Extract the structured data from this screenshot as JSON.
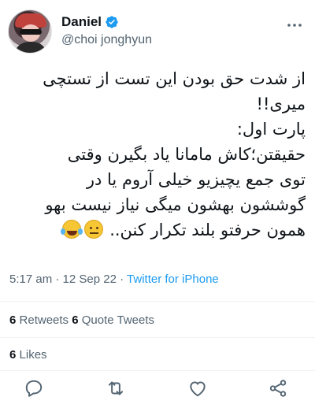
{
  "user": {
    "display_name": "Daniel",
    "handle": "@choi jonghyun",
    "verified": true
  },
  "tweet": {
    "lines": [
      "از شدت حق بودن این تست از تستچی",
      "میری!!",
      "پارت اول:",
      "حقیقتن؛کاش مامانا یاد بگیرن وقتی",
      "توی جمع یچیزیو خیلی آروم یا در",
      "گوششون بهشون میگی نیاز نیست بهو",
      "همون حرفتو بلند تکرار کنن.."
    ],
    "emojis": [
      "neutral-face",
      "face-with-tears-of-joy"
    ]
  },
  "meta": {
    "time": "5:17 am",
    "date": "12 Sep 22",
    "separator": "·",
    "source": "Twitter for iPhone"
  },
  "stats": {
    "retweets_count": "6",
    "retweets_label": "Retweets",
    "quotes_count": "6",
    "quotes_label": "Quote Tweets",
    "likes_count": "6",
    "likes_label": "Likes"
  },
  "actions": [
    "reply-icon",
    "retweet-icon",
    "like-icon",
    "share-icon"
  ],
  "colors": {
    "accent": "#1d9bf0",
    "secondary_text": "#536471",
    "divider": "#eff3f4"
  }
}
